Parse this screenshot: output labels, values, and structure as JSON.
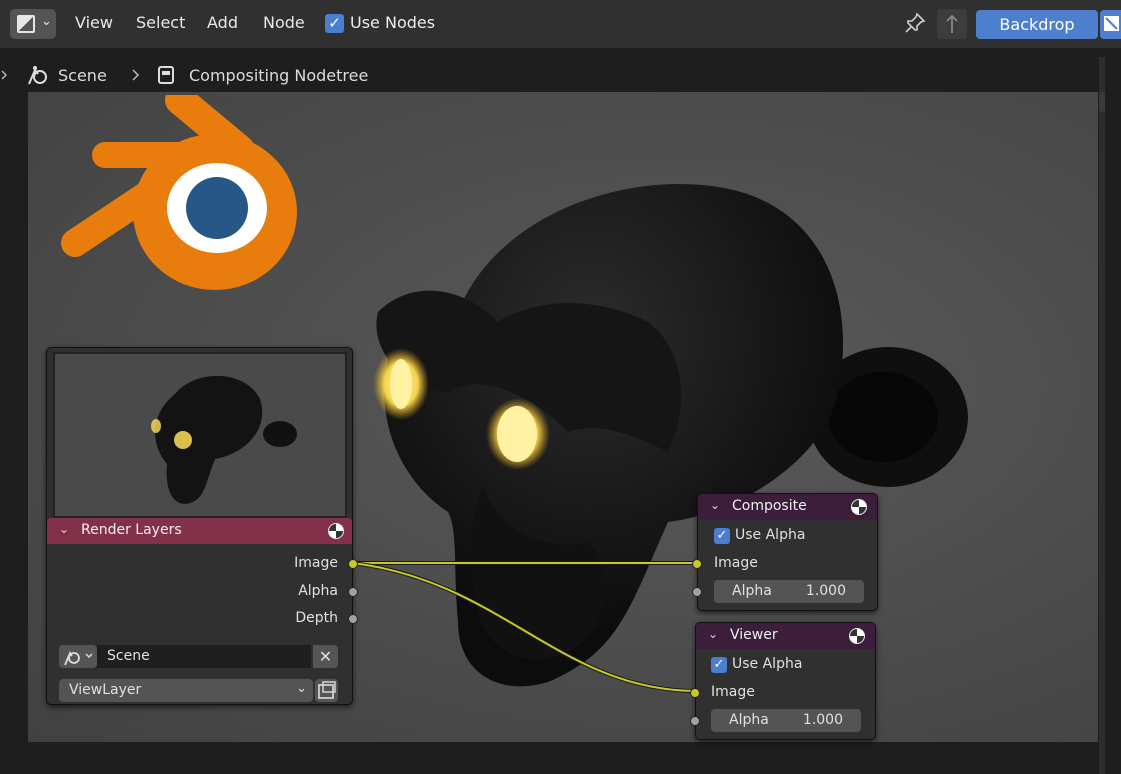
{
  "header": {
    "menus": [
      "View",
      "Select",
      "Add",
      "Node"
    ],
    "use_nodes_label": "Use Nodes",
    "use_nodes_checked": true,
    "backdrop_label": "Backdrop"
  },
  "breadcrumb": {
    "scene": "Scene",
    "tree": "Compositing Nodetree"
  },
  "nodes": {
    "render_layers": {
      "title": "Render Layers",
      "outputs": [
        "Image",
        "Alpha",
        "Depth"
      ],
      "scene_value": "Scene",
      "view_layer_value": "ViewLayer"
    },
    "composite": {
      "title": "Composite",
      "use_alpha_label": "Use Alpha",
      "input_label": "Image",
      "alpha_label": "Alpha",
      "alpha_value": "1.000"
    },
    "viewer": {
      "title": "Viewer",
      "use_alpha_label": "Use Alpha",
      "input_label": "Image",
      "alpha_label": "Alpha",
      "alpha_value": "1.000"
    }
  },
  "colors": {
    "accent": "#4d7fcd",
    "input_node_header": "#83314a",
    "output_node_header": "#3c1d3c",
    "link": "#c8c82a"
  },
  "icons": [
    "editor-type-icon",
    "pin-icon",
    "parent-up-icon",
    "scene-icon",
    "nodetree-icon",
    "render-ball-icon",
    "close-icon",
    "new-view-layer-icon"
  ]
}
